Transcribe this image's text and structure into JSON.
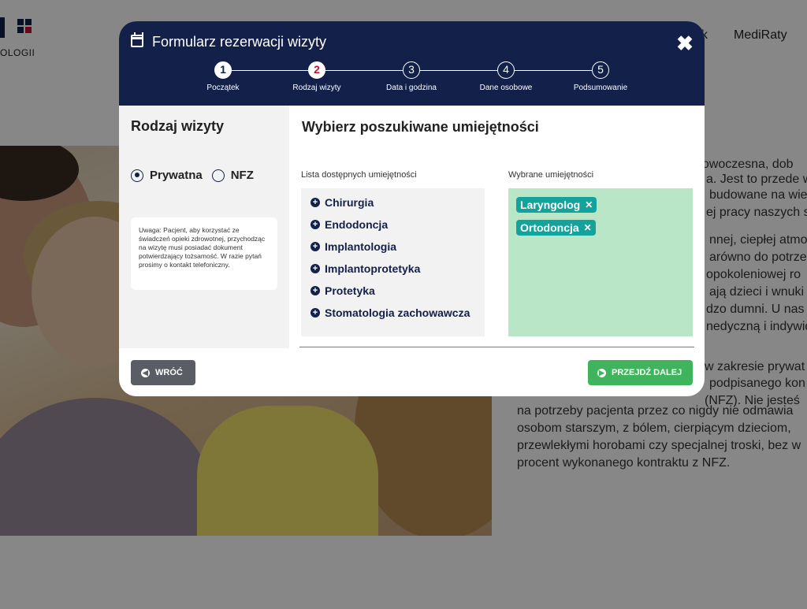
{
  "background": {
    "logo_text": "OLOGII",
    "nav": [
      "k",
      "MediRaty"
    ],
    "text_lines": [
      "nowoczesna, dob",
      "a. Jest to przede w",
      "budowane na wie",
      "ej pracy naszych s",
      "nnej, ciepłej atmos",
      "arówno do potrze",
      "opokoleniowej ro",
      "ają dzieci i wnuki",
      "dzo dumni. U nas",
      "nedyczną i indywid",
      "w zakresie prywat",
      "podpisanego kon",
      "(NFZ). Nie jesteś",
      "na potrzeby pacjenta przez co nigdy nie odmawia",
      "osobom starszym, z bólem, cierpiącym dzieciom,",
      "przewlekłymi horobami czy specjalnej troski, bez w",
      "procent wykonanego kontraktu z NFZ."
    ]
  },
  "modal": {
    "title": "Formularz rezerwacji wizyty",
    "steps": [
      {
        "number": "1",
        "label": "Początek"
      },
      {
        "number": "2",
        "label": "Rodzaj wizyty"
      },
      {
        "number": "3",
        "label": "Data i godzina"
      },
      {
        "number": "4",
        "label": "Dane osobowe"
      },
      {
        "number": "5",
        "label": "Podsumowanie"
      }
    ],
    "left": {
      "title": "Rodzaj wizyty",
      "options": [
        {
          "label": "Prywatna",
          "checked": true
        },
        {
          "label": "NFZ",
          "checked": false
        }
      ],
      "note": "Uwaga: Pacjent, aby korzystać ze świadczeń opieki zdrowotnej, przychodząc na wizytę musi posiadać dokument potwierdzający tożsamość. W razie pytań prosimy o kontakt telefoniczny."
    },
    "right": {
      "title": "Wybierz poszukiwane umiejętności",
      "available_label": "Lista dostępnych umiejętności",
      "selected_label": "Wybrane umiejętności",
      "available": [
        "Chirurgia",
        "Endodoncja",
        "Implantologia",
        "Implantoprotetyka",
        "Protetyka",
        "Stomatologia zachowawcza"
      ],
      "selected": [
        "Laryngolog",
        "Ortodoncja"
      ]
    },
    "buttons": {
      "back": "WRÓĆ",
      "next": "PRZEJDŹ DALEJ"
    }
  }
}
